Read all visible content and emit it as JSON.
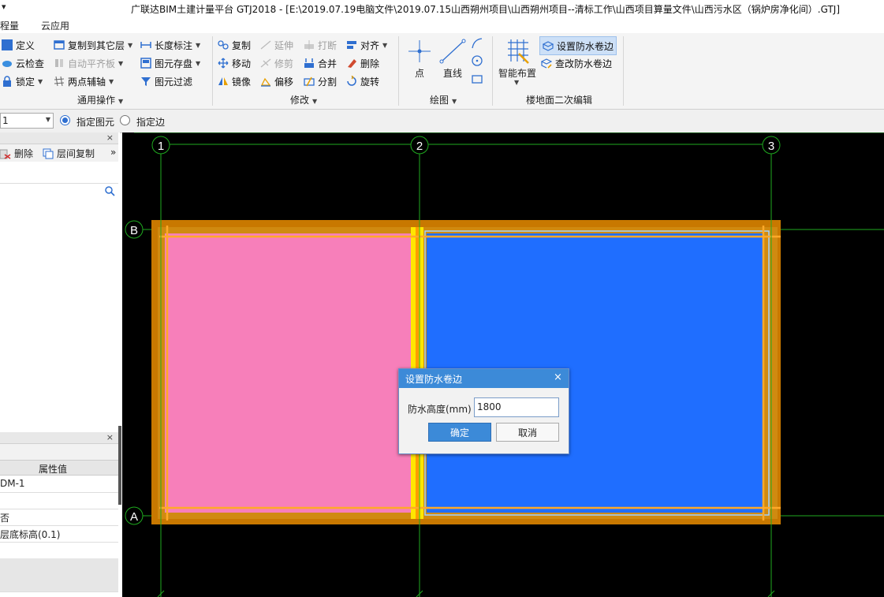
{
  "titlebar": {
    "left_glyph": "▾",
    "title": "广联达BIM土建计量平台 GTJ2018 - [E:\\2019.07.19电脑文件\\2019.07.15山西朔州项目\\山西朔州项目--清标工作\\山西项目算量文件\\山西污水区（锅炉房净化间）.GTJ]"
  },
  "menu": {
    "items": [
      "程量",
      "云应用"
    ]
  },
  "ribbon": {
    "general": {
      "label": "通用操作",
      "define": "定义",
      "cloud_check": "云检查",
      "lock": "锁定",
      "copy_to_floor": "复制到其它层",
      "auto_flush": "自动平齐板",
      "two_point_axis": "两点辅轴",
      "length_mark": "长度标注",
      "save_element": "图元存盘",
      "element_filter": "图元过滤"
    },
    "modify": {
      "label": "修改",
      "copy": "复制",
      "move": "移动",
      "mirror": "镜像",
      "extend": "延伸",
      "trim": "修剪",
      "offset": "偏移",
      "break": "打断",
      "merge": "合并",
      "split": "分割",
      "align": "对齐",
      "delete": "删除",
      "rotate": "旋转"
    },
    "draw": {
      "label": "绘图",
      "point": "点",
      "line": "直线"
    },
    "floor_edit": {
      "label": "楼地面二次编辑",
      "smart_layout": "智能布置",
      "set_waterproof_edge": "设置防水卷边",
      "check_waterproof_edge": "查改防水卷边"
    }
  },
  "optbar": {
    "floor_value": "1",
    "radio_element": "指定图元",
    "radio_edge": "指定边"
  },
  "left_panel": {
    "close": "×",
    "delete": "删除",
    "floor_copy": "层间复制",
    "more": "»",
    "prop_close": "×",
    "prop_header": "属性值",
    "prop_rows": [
      "DM-1",
      "",
      "否",
      "层底标高(0.1)",
      "",
      "",
      ""
    ]
  },
  "canvas": {
    "axis_labels": [
      "1",
      "2",
      "3",
      "B",
      "A"
    ],
    "colors": {
      "pink_room": "#f77fba",
      "blue_room": "#1f6eff",
      "wall": "#c87800",
      "grid": "#1faa1f"
    }
  },
  "dialog": {
    "title": "设置防水卷边",
    "close": "×",
    "field_label": "防水高度(mm)",
    "field_value": "1800",
    "ok": "确定",
    "cancel": "取消"
  }
}
